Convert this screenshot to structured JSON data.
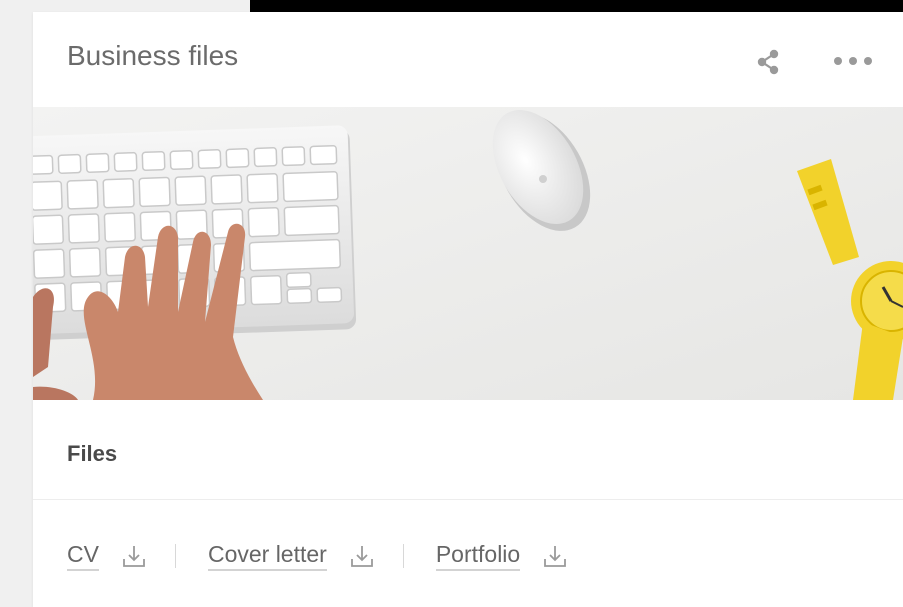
{
  "card": {
    "title": "Business files",
    "share_icon": "share-icon",
    "more_icon": "more-horizontal-icon"
  },
  "hero": {
    "subject": "desk-photo-keyboard-mouse-watch"
  },
  "files_section": {
    "title": "Files",
    "items": [
      {
        "label": "CV",
        "icon": "download-icon"
      },
      {
        "label": "Cover letter",
        "icon": "download-icon"
      },
      {
        "label": "Portfolio",
        "icon": "download-icon"
      }
    ]
  },
  "colors": {
    "page_bg": "#f0f0f0",
    "card_bg": "#ffffff",
    "text_muted": "#6b6b6b",
    "icon_gray": "#9a9a9a",
    "watch_yellow": "#f2d22b"
  }
}
